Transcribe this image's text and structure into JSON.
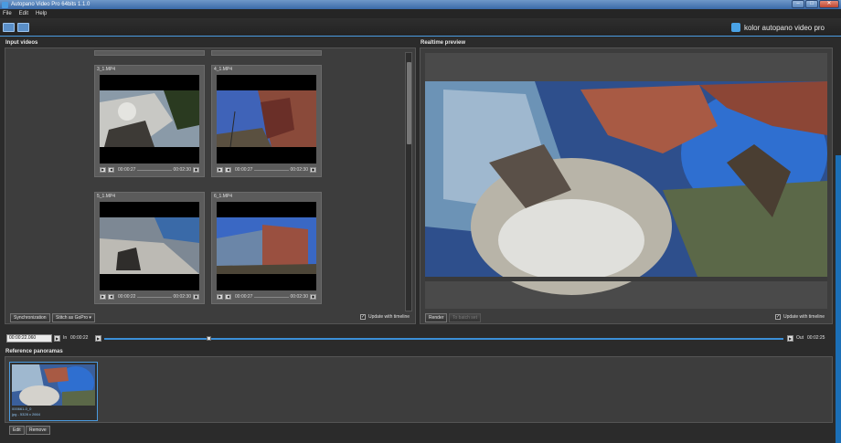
{
  "window": {
    "title": "Autopano Video Pro 64bits 1.1.0",
    "buttons": [
      "–",
      "□",
      "✕"
    ]
  },
  "menu": [
    "File",
    "Edit",
    "Help"
  ],
  "brand": {
    "text": "kolor autopano video pro"
  },
  "input_videos": {
    "title": "Input videos",
    "tiles": [
      {
        "name": "3_1.MP4",
        "current": "00:00:27",
        "total": "00:02:30"
      },
      {
        "name": "4_1.MP4",
        "current": "00:00:27",
        "total": "00:02:30"
      },
      {
        "name": "5_1.MP4",
        "current": "00:00:22",
        "total": "00:02:30"
      },
      {
        "name": "6_1.MP4",
        "current": "00:00:27",
        "total": "00:02:30"
      }
    ],
    "sync_button": "Synchronization",
    "stitch_button": "Stitch  as GoPro",
    "update_label": "Update with timeline",
    "update_checked": true
  },
  "realtime_preview": {
    "title": "Realtime preview",
    "render_button": "Render",
    "batch_button": "To batch set",
    "update_label": "Update with timeline",
    "update_checked": true
  },
  "timeline": {
    "current": "00:00:22.060",
    "in_label": "In",
    "in_time": "00:00:22",
    "out_label": "Out",
    "out_time": "00:02:25"
  },
  "reference_panoramas": {
    "title": "Reference panoramas",
    "items": [
      {
        "name": "000661-0_0",
        "info": "jpg - 5328 x 2664"
      }
    ],
    "edit_button": "Edit",
    "remove_button": "Remove"
  },
  "colors": {
    "accent": "#3b8fd8",
    "panel": "#3d3d3d",
    "background": "#2b2b2b"
  },
  "icons": [
    "app-icon",
    "play-icon",
    "rewind-icon",
    "fullscreen-icon",
    "checkbox-check-icon",
    "kolor-logo-icon"
  ]
}
